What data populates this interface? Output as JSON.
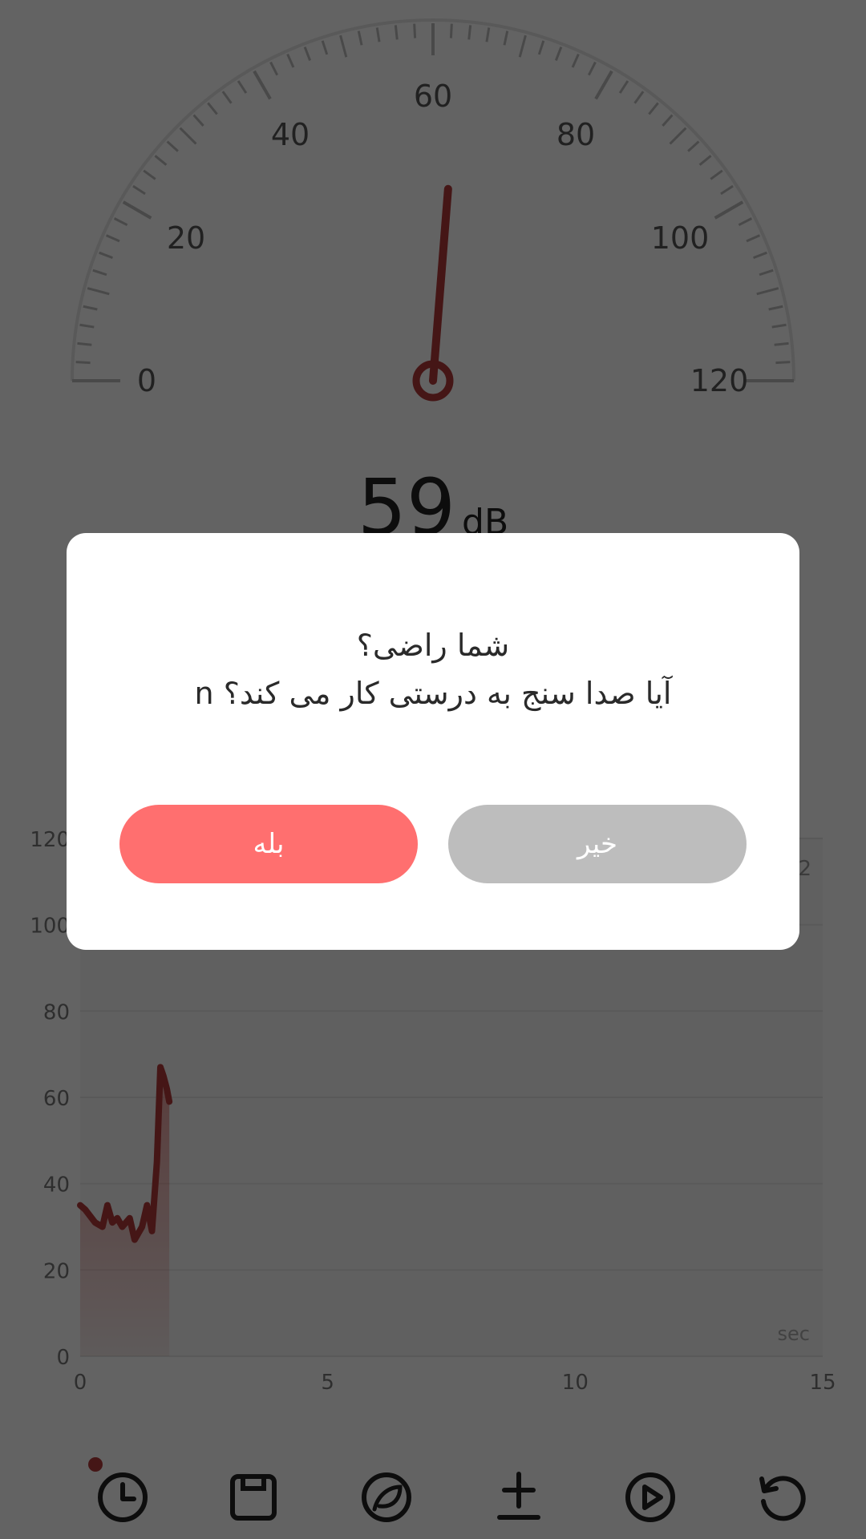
{
  "gauge": {
    "labels": [
      "0",
      "20",
      "40",
      "60",
      "80",
      "100",
      "120"
    ],
    "min": 0,
    "max": 120,
    "needle_value": 63
  },
  "reading": {
    "value": "59",
    "unit": "dB"
  },
  "chart_data": {
    "type": "area",
    "x_ticks": [
      "0",
      "5",
      "10",
      "15"
    ],
    "y_ticks": [
      "0",
      "20",
      "40",
      "60",
      "80",
      "100",
      "120"
    ],
    "xlim": [
      0,
      15
    ],
    "ylim": [
      0,
      120
    ],
    "x_unit": "sec",
    "right_partial_label": "2",
    "series": [
      {
        "x": [
          0,
          0.1,
          0.3,
          0.45,
          0.55,
          0.65,
          0.75,
          0.85,
          1.0,
          1.1,
          1.25,
          1.35,
          1.45,
          1.55,
          1.62,
          1.68,
          1.75,
          1.8
        ],
        "values": [
          35,
          34,
          31,
          30,
          35,
          31,
          32,
          30,
          32,
          27,
          30,
          35,
          29,
          45,
          67,
          65,
          62,
          59
        ]
      }
    ],
    "line_color": "#b33a3a"
  },
  "toolbar": {
    "icons": [
      "history-icon",
      "save-icon",
      "lens-icon",
      "calibrate-icon",
      "play-icon",
      "reset-icon"
    ],
    "notification_dot_color": "#b33a3a"
  },
  "dialog": {
    "title": "شما راضی؟",
    "message": "آیا صدا سنج به درستی کار می کند؟ n",
    "yes_label": "بله",
    "no_label": "خیر",
    "yes_color": "#ff6f6f",
    "no_color": "#bdbdbd"
  }
}
